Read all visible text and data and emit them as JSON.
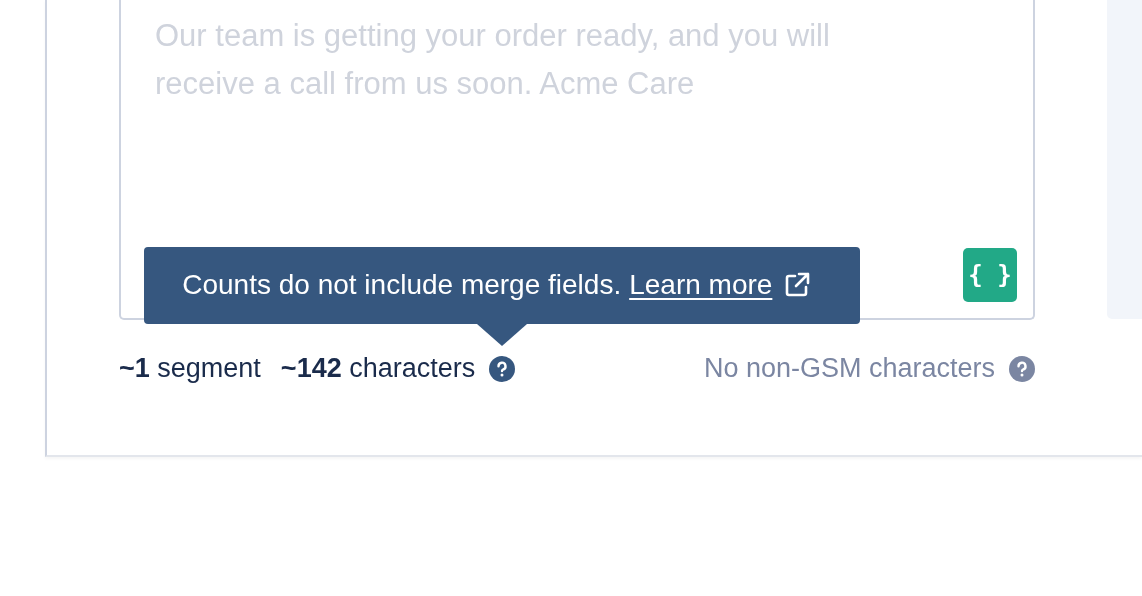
{
  "message_body": {
    "lines": [
      "Our team is getting your order ready, and you will",
      "receive a call from us soon. Acme Care"
    ]
  },
  "merge_field_button": {
    "label": "{ }"
  },
  "tooltip": {
    "text": "Counts do not include merge fields.",
    "link": "Learn more"
  },
  "counters": {
    "segments": "**~1** segment",
    "characters": "**~142** characters",
    "encoding": "No non-GSM characters"
  }
}
